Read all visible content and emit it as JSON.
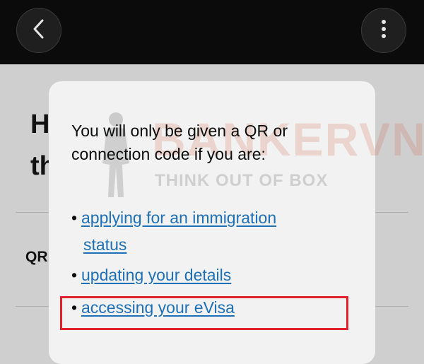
{
  "topbar": {
    "back_icon": "chevron-left-icon",
    "menu_icon": "kebab-menu-icon"
  },
  "background": {
    "heading_line1": "H",
    "heading_line2": "th",
    "row_label": "QR"
  },
  "sheet": {
    "intro": "You will only be given a QR or connection code if you are:",
    "items": [
      {
        "label_line1": "applying for an immigration",
        "label_line2": "status"
      },
      {
        "label": "updating your details"
      },
      {
        "label": "accessing your eVisa"
      }
    ]
  },
  "watermark": {
    "brand": "BANKERVN",
    "tagline": "THINK OUT OF BOX"
  },
  "colors": {
    "link": "#1d70b8",
    "highlight": "#e0202a",
    "topbar": "#0b0b0b"
  }
}
